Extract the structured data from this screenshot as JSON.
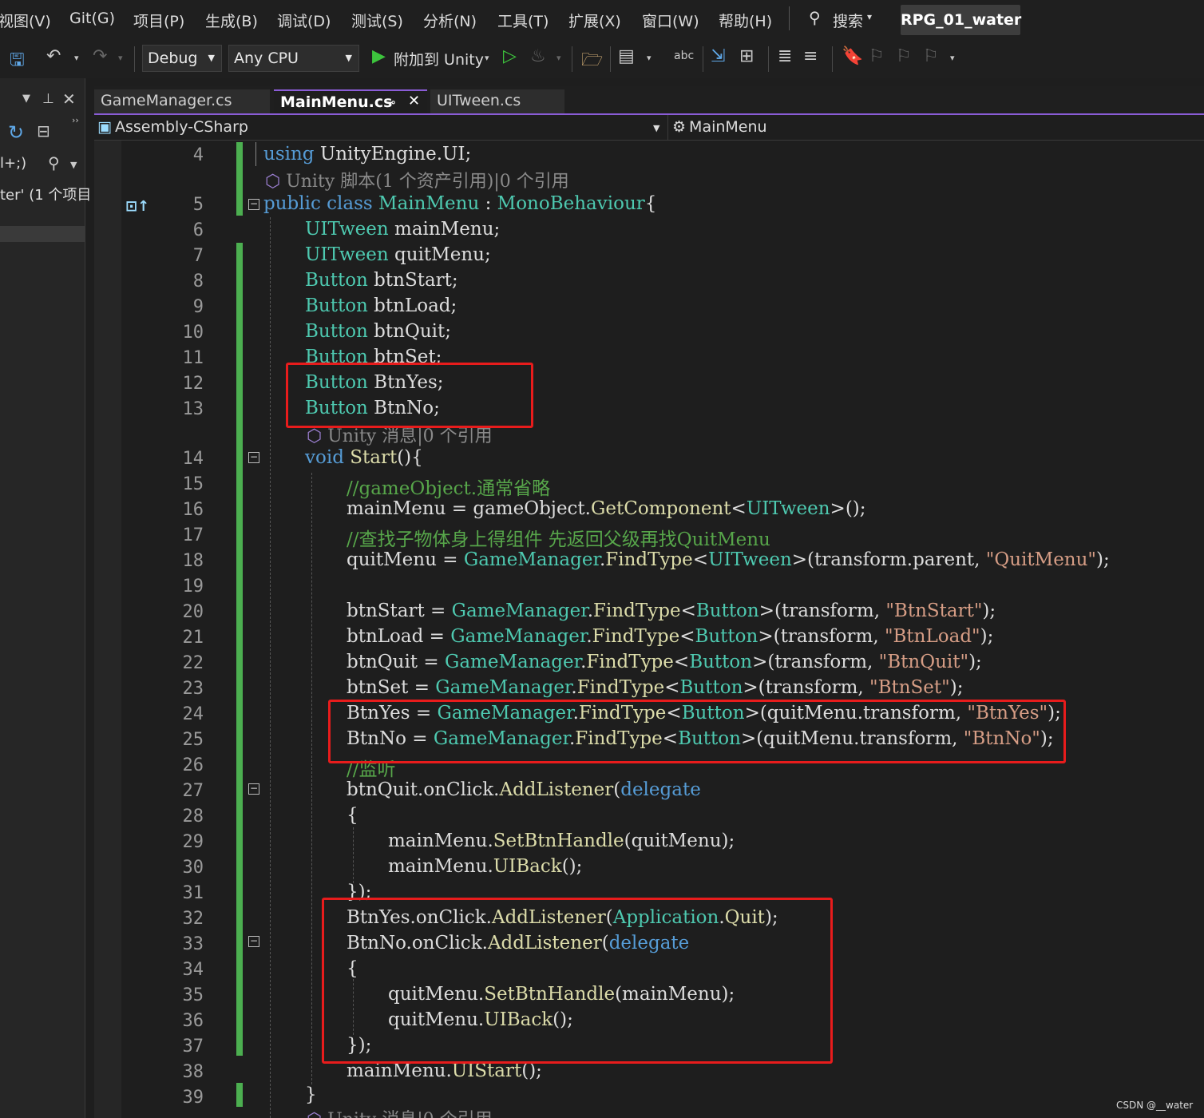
{
  "menu": [
    "视图(V)",
    "Git(G)",
    "项目(P)",
    "生成(B)",
    "调试(D)",
    "测试(S)",
    "分析(N)",
    "工具(T)",
    "扩展(X)",
    "窗口(W)",
    "帮助(H)"
  ],
  "search": {
    "label": "搜索"
  },
  "project_name": "RPG_01_water",
  "toolbar": {
    "config": "Debug",
    "platform": "Any CPU",
    "attach_label": "附加到 Unity"
  },
  "left_panel": {
    "filter_text": "l+;)",
    "item_text": "ter' (1 个项目"
  },
  "tabs": [
    {
      "label": "GameManager.cs"
    },
    {
      "label": "MainMenu.cs"
    },
    {
      "label": "UITween.cs"
    }
  ],
  "navbar": {
    "project": "Assembly-CSharp",
    "class": "MainMenu"
  },
  "lens": {
    "class_refs": "Unity 脚本(1 个资产引用)|0 个引用",
    "start_refs": "Unity 消息|0 个引用",
    "bottom_refs": "Unity 消息|0 个引用"
  },
  "line_numbers": [
    "4",
    "5",
    "6",
    "7",
    "8",
    "9",
    "10",
    "11",
    "12",
    "13",
    "14",
    "15",
    "16",
    "17",
    "18",
    "19",
    "20",
    "21",
    "22",
    "23",
    "24",
    "25",
    "26",
    "27",
    "28",
    "29",
    "30",
    "31",
    "32",
    "33",
    "34",
    "35",
    "36",
    "37",
    "38",
    "39"
  ],
  "code": {
    "l4": [
      "using",
      " UnityEngine.UI;"
    ],
    "l5": [
      "public class",
      " ",
      "MainMenu",
      " : ",
      "MonoBehaviour",
      "{"
    ],
    "l6": [
      "UITween",
      " mainMenu;"
    ],
    "l7": [
      "UITween",
      " quitMenu;"
    ],
    "l8": [
      "Button",
      " btnStart;"
    ],
    "l9": [
      "Button",
      " btnLoad;"
    ],
    "l10": [
      "Button",
      " btnQuit;"
    ],
    "l11": [
      "Button",
      " btnSet;"
    ],
    "l12": [
      "Button",
      " BtnYes;"
    ],
    "l13": [
      "Button",
      " BtnNo;"
    ],
    "l14": [
      "void",
      " ",
      "Start",
      "(){"
    ],
    "l15": "//gameObject.通常省略",
    "l16": [
      "mainMenu = gameObject.",
      "GetComponent",
      "<",
      "UITween",
      ">();"
    ],
    "l17": "//查找子物体身上得组件 先返回父级再找QuitMenu",
    "l18": [
      "quitMenu = ",
      "GameManager",
      ".",
      "FindType",
      "<",
      "UITween",
      ">(transform.parent, ",
      "\"QuitMenu\"",
      ");"
    ],
    "l20": [
      "btnStart = ",
      "GameManager",
      ".",
      "FindType",
      "<",
      "Button",
      ">(transform, ",
      "\"BtnStart\"",
      ");"
    ],
    "l21": [
      "btnLoad = ",
      "GameManager",
      ".",
      "FindType",
      "<",
      "Button",
      ">(transform, ",
      "\"BtnLoad\"",
      ");"
    ],
    "l22": [
      "btnQuit = ",
      "GameManager",
      ".",
      "FindType",
      "<",
      "Button",
      ">(transform, ",
      "\"BtnQuit\"",
      ");"
    ],
    "l23": [
      "btnSet = ",
      "GameManager",
      ".",
      "FindType",
      "<",
      "Button",
      ">(transform, ",
      "\"BtnSet\"",
      ");"
    ],
    "l24": [
      "BtnYes = ",
      "GameManager",
      ".",
      "FindType",
      "<",
      "Button",
      ">(quitMenu.transform, ",
      "\"BtnYes\"",
      ");"
    ],
    "l25": [
      "BtnNo = ",
      "GameManager",
      ".",
      "FindType",
      "<",
      "Button",
      ">(quitMenu.transform, ",
      "\"BtnNo\"",
      ");"
    ],
    "l26": "//监听",
    "l27": [
      "btnQuit.onClick.",
      "AddListener",
      "(",
      "delegate"
    ],
    "l28": "{",
    "l29": [
      "mainMenu.",
      "SetBtnHandle",
      "(quitMenu);"
    ],
    "l30": [
      "mainMenu.",
      "UIBack",
      "();"
    ],
    "l31": "});",
    "l32": [
      "BtnYes.onClick.",
      "AddListener",
      "(",
      "Application",
      ".",
      "Quit",
      ");"
    ],
    "l33": [
      "BtnNo.onClick.",
      "AddListener",
      "(",
      "delegate"
    ],
    "l34": "{",
    "l35": [
      "quitMenu.",
      "SetBtnHandle",
      "(mainMenu);"
    ],
    "l36": [
      "quitMenu.",
      "UIBack",
      "();"
    ],
    "l37": "});",
    "l38": [
      "mainMenu.",
      "UIStart",
      "();"
    ],
    "l39": "}"
  },
  "watermark": "CSDN @__water",
  "colors": {
    "keyword": "#569cd6",
    "type": "#4ec9b0",
    "string": "#d69d85",
    "comment": "#57a64a",
    "method": "#dcdcaa",
    "highlight_box": "#e81c1c",
    "accent": "#8a5cd6"
  }
}
